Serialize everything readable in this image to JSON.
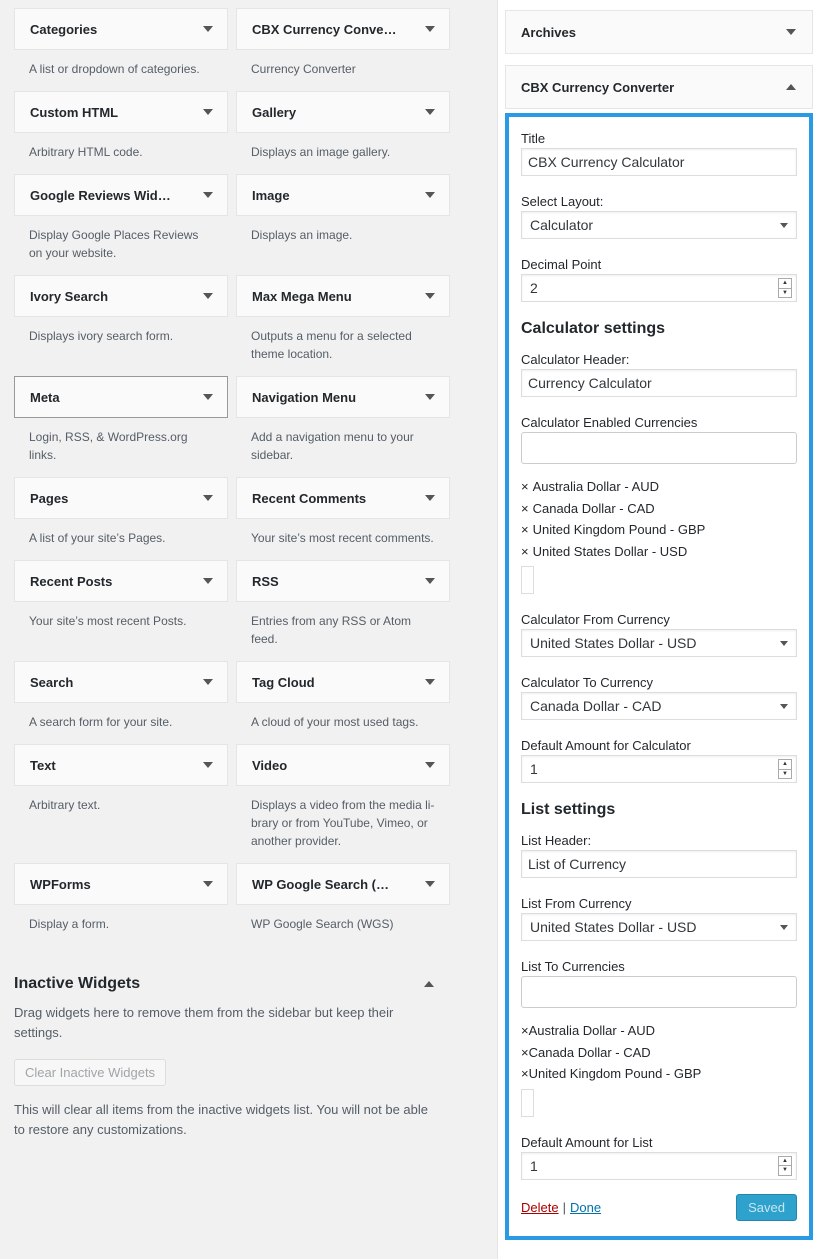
{
  "available_widgets": [
    {
      "title": "Categories",
      "desc": "A list or dropdown of categories."
    },
    {
      "title": "CBX Currency Conve…",
      "desc": "Currency Converter"
    },
    {
      "title": "Custom HTML",
      "desc": "Arbitrary HTML code."
    },
    {
      "title": "Gallery",
      "desc": "Displays an image gallery."
    },
    {
      "title": "Google Reviews Wid…",
      "desc": "Display Google Places Reviews on your website."
    },
    {
      "title": "Image",
      "desc": "Displays an image."
    },
    {
      "title": "Ivory Search",
      "desc": "Displays ivory search form."
    },
    {
      "title": "Max Mega Menu",
      "desc": "Outputs a menu for a selected theme location."
    },
    {
      "title": "Meta",
      "desc": "Login, RSS, & WordPress.org links."
    },
    {
      "title": "Navigation Menu",
      "desc": "Add a navigation menu to your sidebar."
    },
    {
      "title": "Pages",
      "desc": "A list of your site’s Pages."
    },
    {
      "title": "Recent Comments",
      "desc": "Your site’s most recent comments."
    },
    {
      "title": "Recent Posts",
      "desc": "Your site’s most recent Posts."
    },
    {
      "title": "RSS",
      "desc": "Entries from any RSS or Atom feed."
    },
    {
      "title": "Search",
      "desc": "A search form for your site."
    },
    {
      "title": "Tag Cloud",
      "desc": "A cloud of your most used tags."
    },
    {
      "title": "Text",
      "desc": "Arbitrary text."
    },
    {
      "title": "Video",
      "desc": "Displays a video from the media li-brary or from YouTube, Vimeo, or another provider."
    },
    {
      "title": "WPForms",
      "desc": "Display a form."
    },
    {
      "title": "WP Google Search (…",
      "desc": "WP Google Search (WGS)"
    }
  ],
  "inactive": {
    "heading": "Inactive Widgets",
    "description": "Drag widgets here to remove them from the sidebar but keep their settings.",
    "clear_button": "Clear Inactive Widgets",
    "note": "This will clear all items from the inactive widgets list. You will not be able to restore any customizations."
  },
  "sidebar": {
    "archives_title": "Archives",
    "cbx_title": "CBX Currency Converter"
  },
  "cbx_form": {
    "title_label": "Title",
    "title_value": "CBX Currency Calculator",
    "layout_label": "Select Layout:",
    "layout_value": "Calculator",
    "decimal_label": "Decimal Point",
    "decimal_value": "2",
    "calc_section": "Calculator settings",
    "calc_header_label": "Calculator Header:",
    "calc_header_value": "Currency Calculator",
    "calc_enabled_label": "Calculator Enabled Currencies",
    "calc_enabled_tags": [
      "Australia Dollar - AUD",
      "Canada Dollar - CAD",
      "United Kingdom Pound - GBP",
      "United States Dollar - USD"
    ],
    "calc_from_label": "Calculator From Currency",
    "calc_from_value": "United States Dollar - USD",
    "calc_to_label": "Calculator To Currency",
    "calc_to_value": "Canada Dollar - CAD",
    "calc_default_label": "Default Amount for Calculator",
    "calc_default_value": "1",
    "list_section": "List settings",
    "list_header_label": "List Header:",
    "list_header_value": "List of Currency",
    "list_from_label": "List From Currency",
    "list_from_value": "United States Dollar - USD",
    "list_to_label": "List To Currencies",
    "list_to_tags": [
      "Australia Dollar - AUD",
      "Canada Dollar - CAD",
      "United Kingdom Pound - GBP"
    ],
    "list_default_label": "Default Amount for List",
    "list_default_value": "1",
    "delete_link": "Delete",
    "separator": "|",
    "done_link": "Done",
    "saved_button": "Saved"
  },
  "glyphs": {
    "remove": "×",
    "spin_up": "▲",
    "spin_down": "▼"
  },
  "colors": {
    "accent_border": "#2a9ae5",
    "delete": "#aa0000",
    "link": "#0073aa",
    "saved_btn": "#2ea2cc"
  }
}
